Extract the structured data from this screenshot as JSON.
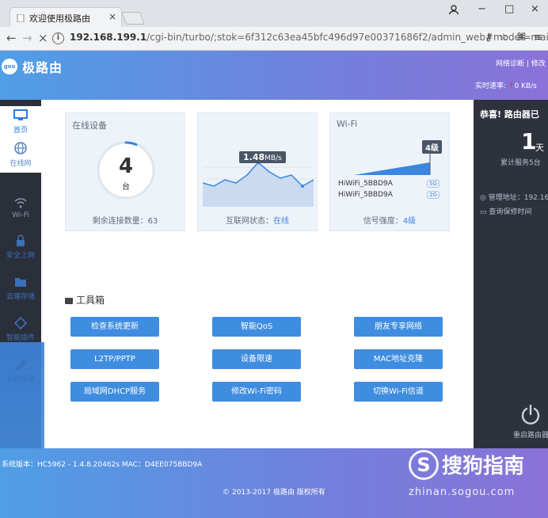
{
  "browser": {
    "tab_title": "欢迎使用极路由",
    "tab_close": "×",
    "url_bold": "192.168.199.1",
    "url_rest": "/cgi-bin/turbo/;stok=6f312c63ea45bfc496d97e00371686f2/admin_web#model=main_v...",
    "window_buttons": [
      "−",
      "□",
      "×"
    ]
  },
  "header": {
    "logo_text": "geo",
    "brand": "极路由",
    "links": "网络诊断 | 修改",
    "speed_label": "实时速率:",
    "speed_value": "0 KB/s"
  },
  "sidebar": {
    "items": [
      {
        "label": "首页",
        "icon": "monitor-icon"
      },
      {
        "label": "在线网",
        "icon": "globe-icon"
      },
      {
        "label": "Wi-Fi",
        "icon": "wifi-icon"
      },
      {
        "label": "安全上网",
        "icon": "lock-icon"
      },
      {
        "label": "云端存储",
        "icon": "folder-icon"
      },
      {
        "label": "智能插件",
        "icon": "plugin-icon"
      },
      {
        "label": "系统设置",
        "icon": "wrench-icon"
      }
    ]
  },
  "cards": {
    "devices": {
      "title": "在线设备",
      "count": "4",
      "unit": "台",
      "footer": "剩余连接数量：63",
      "remaining_ratio": 0.06
    },
    "internet": {
      "title": "",
      "speed": "1.48",
      "speed_unit": "MB/s",
      "footer_label": "互联网状态：",
      "footer_status": "在线"
    },
    "wifi": {
      "title": "Wi-Fi",
      "level": "4级",
      "ssids": [
        {
          "name": "HiWiFi_5BBD9A",
          "band": "5G"
        },
        {
          "name": "HiWiFi_5BBD9A",
          "band": "2G"
        }
      ],
      "footer_label": "信号强度：",
      "footer_value": "4级"
    }
  },
  "toolbox": {
    "heading": "工具箱",
    "buttons": [
      "检查系统更新",
      "智能QoS",
      "朋友专享网络",
      "L2TP/PPTP",
      "设备限速",
      "MAC地址克隆",
      "局域网DHCP服务",
      "修改Wi-Fi密码",
      "切换Wi-Fi信道"
    ]
  },
  "right_panel": {
    "congrats": "恭喜! 路由器已",
    "days": "1",
    "days_unit": "天",
    "service": "累计服务5台",
    "mgmt": "管理地址：192.16",
    "warranty": "查询保修时间",
    "restart": "重启路由器"
  },
  "footer": {
    "version": "系统版本：HC5962 - 1.4.8.20462s    MAC：D4EE075BBD9A",
    "copyright": "© 2013-2017 极路由 版权所有"
  },
  "watermark": {
    "brand": "搜狗指南",
    "url": "zhinan.sogou.com"
  }
}
